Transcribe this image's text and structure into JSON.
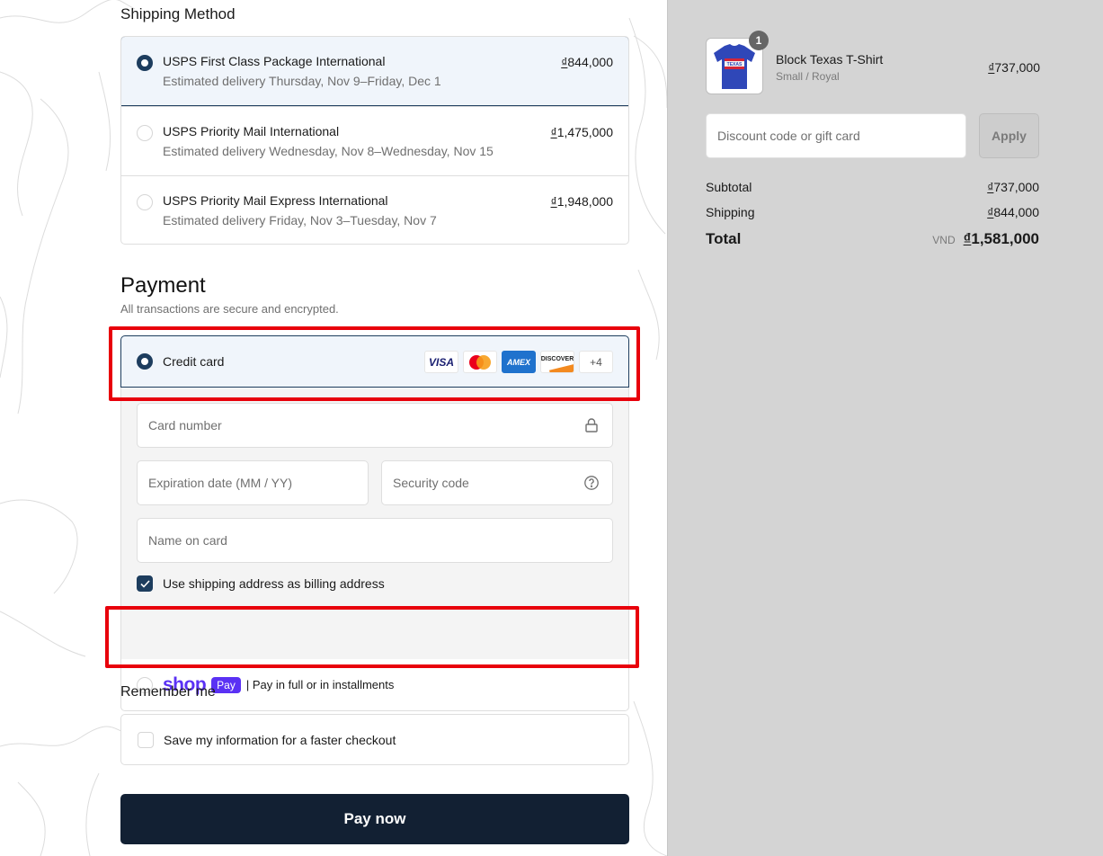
{
  "shipping": {
    "title": "Shipping Method",
    "options": [
      {
        "name": "USPS First Class Package International",
        "eta": "Estimated delivery Thursday, Nov 9–Friday, Dec 1",
        "currency_symbol": "₫",
        "amount": "844,000",
        "selected": true
      },
      {
        "name": "USPS Priority Mail International",
        "eta": "Estimated delivery Wednesday, Nov 8–Wednesday, Nov 15",
        "currency_symbol": "₫",
        "amount": "1,475,000",
        "selected": false
      },
      {
        "name": "USPS Priority Mail Express International",
        "eta": "Estimated delivery Friday, Nov 3–Tuesday, Nov 7",
        "currency_symbol": "₫",
        "amount": "1,948,000",
        "selected": false
      }
    ]
  },
  "payment": {
    "title": "Payment",
    "subtitle": "All transactions are secure and encrypted.",
    "credit_card": {
      "label": "Credit card",
      "selected": true,
      "brands": [
        "VISA",
        "Mastercard",
        "AMEX",
        "DISCOVER"
      ],
      "brand_labels": {
        "visa": "VISA",
        "amex": "AMEX",
        "discover": "DISCOVER",
        "more": "+4"
      },
      "fields": {
        "card_number": {
          "placeholder": "Card number",
          "icon": "lock-icon"
        },
        "expiration": {
          "placeholder": "Expiration date (MM / YY)"
        },
        "security_code": {
          "placeholder": "Security code",
          "icon": "help-circle-icon"
        },
        "name_on_card": {
          "placeholder": "Name on card"
        }
      },
      "billing_checkbox": {
        "label": "Use shipping address as billing address",
        "checked": true
      }
    },
    "shop_pay": {
      "brand_word": "shop",
      "brand_badge": "Pay",
      "label": "| Pay in full or in installments",
      "selected": false
    }
  },
  "remember": {
    "title": "Remember me",
    "checkbox_label": "Save my information for a faster checkout",
    "checked": false
  },
  "pay_button": "Pay now",
  "summary": {
    "item": {
      "quantity": "1",
      "name": "Block Texas T-Shirt",
      "variant": "Small / Royal",
      "currency_symbol": "₫",
      "price": "737,000",
      "image_text": "TEXAS"
    },
    "discount": {
      "placeholder": "Discount code or gift card",
      "value": ""
    },
    "apply_label": "Apply",
    "subtotal_label": "Subtotal",
    "subtotal_symbol": "₫",
    "subtotal_value": "737,000",
    "shipping_label": "Shipping",
    "shipping_symbol": "₫",
    "shipping_value": "844,000",
    "total_label": "Total",
    "total_currency": "VND",
    "total_symbol": "₫",
    "total_value": "1,581,000"
  },
  "colors": {
    "accent": "#1d3d5e",
    "pay_button": "#122033",
    "shop_pay": "#5a31f4",
    "highlight_box": "#e8000b",
    "summary_bg": "#d4d4d4"
  }
}
